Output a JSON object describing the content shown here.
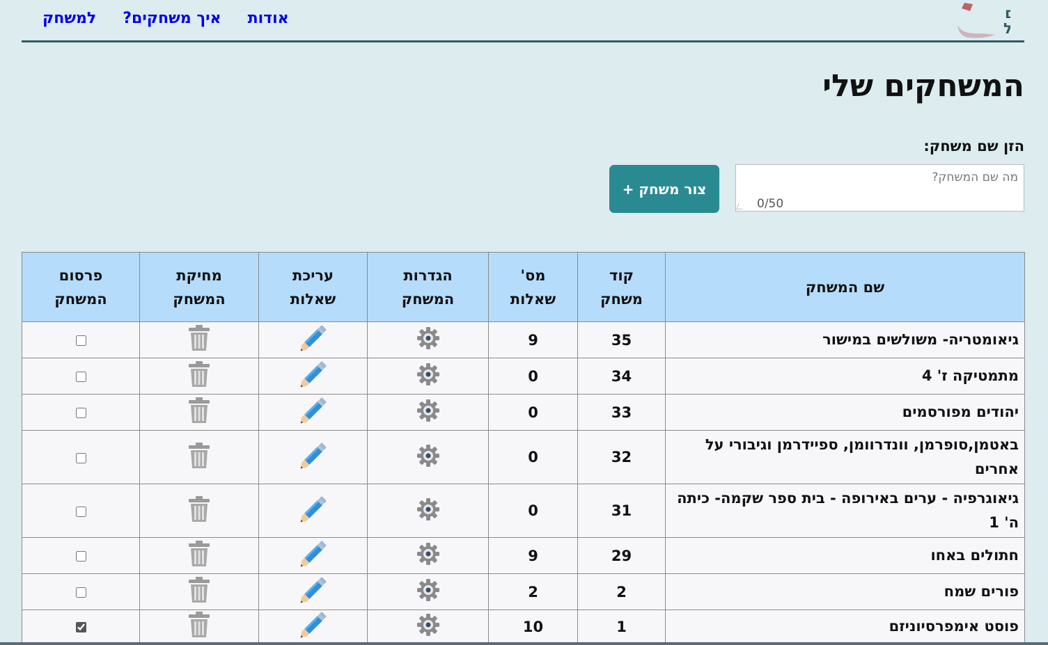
{
  "logo": {
    "text": "עפים בחלל"
  },
  "nav": {
    "about": "אודות",
    "how_to_play": "איך משחקים?",
    "to_game": "למשחק"
  },
  "page_title": "המשחקים שלי",
  "form": {
    "label": "הזן שם משחק:",
    "placeholder": "מה שם המשחק?",
    "value": "",
    "counter": "0/50",
    "create_button": "צור משחק +"
  },
  "table": {
    "headers": {
      "name": [
        "שם המשחק"
      ],
      "code": [
        "קוד",
        "משחק"
      ],
      "questions_count": [
        "מס'",
        "שאלות"
      ],
      "settings": [
        "הגדרות",
        "המשחק"
      ],
      "edit": [
        "עריכת",
        "שאלות"
      ],
      "delete": [
        "מחיקת",
        "המשחק"
      ],
      "publish": [
        "פרסום",
        "המשחק"
      ]
    },
    "rows": [
      {
        "name": "גיאומטריה- משולשים במישור",
        "code": "35",
        "questions": "9",
        "published": false
      },
      {
        "name": "מתמטיקה ז' 4",
        "code": "34",
        "questions": "0",
        "published": false
      },
      {
        "name": "יהודים מפורסמים",
        "code": "33",
        "questions": "0",
        "published": false
      },
      {
        "name": "באטמן,סופרמן, וונדרוומן, ספיידרמן וגיבורי על אחרים",
        "code": "32",
        "questions": "0",
        "published": false
      },
      {
        "name": "גיאוגרפיה - ערים באירופה - בית ספר שקמה- כיתה ה' 1",
        "code": "31",
        "questions": "0",
        "published": false
      },
      {
        "name": "חתולים באחו",
        "code": "29",
        "questions": "9",
        "published": false
      },
      {
        "name": "פורים שמח",
        "code": "2",
        "questions": "2",
        "published": false
      },
      {
        "name": "פוסט אימפרסיוניזם",
        "code": "1",
        "questions": "10",
        "published": true
      }
    ],
    "icons": {
      "settings": "gear-icon",
      "edit": "pencil-icon",
      "delete": "trash-icon"
    }
  },
  "colors": {
    "page_bg": "#dcecef",
    "header_bg": "#b5dcfb",
    "button_bg": "#2a8a92",
    "nav_link": "#0000ee",
    "pencil": "#2f8fd8",
    "gear": "#8a8a8a",
    "trash": "#9a9a9a"
  }
}
